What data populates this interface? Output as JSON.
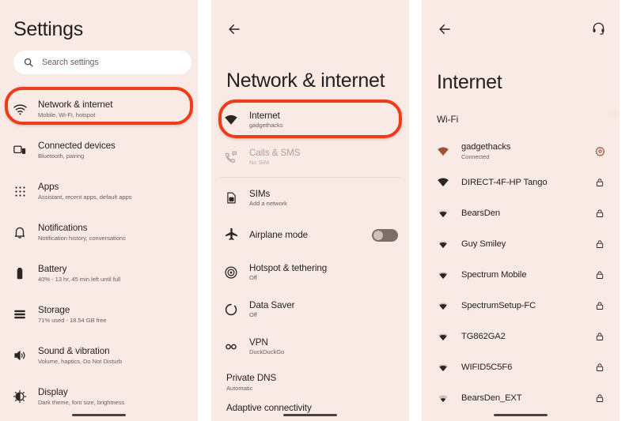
{
  "theme": {
    "panel_bg": "#faeae5",
    "page_bg": "#ffffff",
    "accent": "#9c5538",
    "highlight_red": "#ef3b18",
    "toggle_on": "#8a4a35",
    "toggle_off": "#7d6e6a",
    "text_primary": "#231f1e",
    "text_secondary": "#6d5f5b",
    "text_disabled": "#b0a09b"
  },
  "panel_settings": {
    "title": "Settings",
    "search": {
      "placeholder": "Search settings",
      "icon": "search-icon"
    },
    "highlighted_item": "Network & internet",
    "items": [
      {
        "icon": "wifi-icon",
        "title": "Network & internet",
        "subtitle": "Mobile, Wi-Fi, hotspot",
        "highlighted": true
      },
      {
        "icon": "connected-device-icon",
        "title": "Connected devices",
        "subtitle": "Bluetooth, pairing",
        "highlighted": false
      },
      {
        "icon": "apps-grid-icon",
        "title": "Apps",
        "subtitle": "Assistant, recent apps, default apps",
        "highlighted": false
      },
      {
        "icon": "bell-icon",
        "title": "Notifications",
        "subtitle": "Notification history, conversations",
        "highlighted": false
      },
      {
        "icon": "battery-icon",
        "title": "Battery",
        "subtitle": "40% - 13 hr, 45 min left until full",
        "highlighted": false
      },
      {
        "icon": "storage-icon",
        "title": "Storage",
        "subtitle": "71% used - 18.54 GB free",
        "highlighted": false
      },
      {
        "icon": "volume-icon",
        "title": "Sound & vibration",
        "subtitle": "Volume, haptics, Do Not Disturb",
        "highlighted": false
      },
      {
        "icon": "brightness-icon",
        "title": "Display",
        "subtitle": "Dark theme, font size, brightness",
        "highlighted": false
      }
    ]
  },
  "panel_network": {
    "back_icon": "back-arrow-icon",
    "title": "Network & internet",
    "highlighted_item": "Internet",
    "items": [
      {
        "icon": "wifi-icon",
        "title": "Internet",
        "subtitle": "gadgethacks",
        "disabled": false,
        "highlighted": true,
        "toggle": null
      },
      {
        "icon": "calls-sms-icon",
        "title": "Calls & SMS",
        "subtitle": "No SIM",
        "disabled": true,
        "highlighted": false,
        "toggle": null
      },
      {
        "icon": "sim-icon",
        "title": "SIMs",
        "subtitle": "Add a network",
        "disabled": false,
        "highlighted": false,
        "toggle": null
      },
      {
        "icon": "airplane-icon",
        "title": "Airplane mode",
        "subtitle": "",
        "disabled": false,
        "highlighted": false,
        "toggle": "off"
      },
      {
        "icon": "hotspot-icon",
        "title": "Hotspot & tethering",
        "subtitle": "Off",
        "disabled": false,
        "highlighted": false,
        "toggle": null
      },
      {
        "icon": "data-saver-icon",
        "title": "Data Saver",
        "subtitle": "Off",
        "disabled": false,
        "highlighted": false,
        "toggle": null
      },
      {
        "icon": "vpn-icon",
        "title": "VPN",
        "subtitle": "DuckDuckGo",
        "disabled": false,
        "highlighted": false,
        "toggle": null
      }
    ],
    "private_dns": {
      "title": "Private DNS",
      "subtitle": "Automatic"
    },
    "cut_off_item": {
      "title": "Adaptive connectivity"
    }
  },
  "panel_internet": {
    "back_icon": "back-arrow-icon",
    "headset_icon": "headset-icon",
    "title": "Internet",
    "wifi_toggle": {
      "label": "Wi-Fi",
      "state": "on"
    },
    "networks": [
      {
        "name": "gadgethacks",
        "status": "Connected",
        "connected": true,
        "trailing_icon": "gear-icon",
        "signal": "wifi-full-icon"
      },
      {
        "name": "DIRECT-4F-HP Tango",
        "status": "",
        "connected": false,
        "trailing_icon": "lock-icon",
        "signal": "wifi-full-icon"
      },
      {
        "name": "BearsDen",
        "status": "",
        "connected": false,
        "trailing_icon": "lock-icon",
        "signal": "wifi-mid-icon"
      },
      {
        "name": "Guy Smiley",
        "status": "",
        "connected": false,
        "trailing_icon": "lock-icon",
        "signal": "wifi-mid-icon"
      },
      {
        "name": "Spectrum Mobile",
        "status": "",
        "connected": false,
        "trailing_icon": "lock-icon",
        "signal": "wifi-mid-icon"
      },
      {
        "name": "SpectrumSetup-FC",
        "status": "",
        "connected": false,
        "trailing_icon": "lock-icon",
        "signal": "wifi-mid-icon"
      },
      {
        "name": "TG862GA2",
        "status": "",
        "connected": false,
        "trailing_icon": "lock-icon",
        "signal": "wifi-mid-icon"
      },
      {
        "name": "WIFID5C5F6",
        "status": "",
        "connected": false,
        "trailing_icon": "lock-icon",
        "signal": "wifi-mid-icon"
      },
      {
        "name": "BearsDen_EXT",
        "status": "",
        "connected": false,
        "trailing_icon": "lock-icon",
        "signal": "wifi-low-icon"
      }
    ]
  }
}
